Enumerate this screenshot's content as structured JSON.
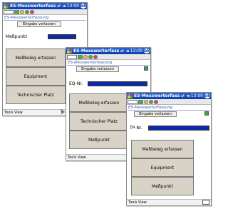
{
  "windows": [
    {
      "title": "ES-Messwerterfass",
      "time": "13:00",
      "subtitle": "ES-Messwerterfassung",
      "exit_button": "Eingabe verlassen",
      "field_label": "Meßpunkt",
      "buttons": [
        "Meßbeleg erfassen",
        "Equipment",
        "Technischer Platz"
      ],
      "menu": "Tools View"
    },
    {
      "title": "ES-Messwerterfass",
      "time": "13:00",
      "subtitle": "ES-Messwerterfassung",
      "exit_button": "Eingabe verlassen",
      "field_label": "EQ-Nr.",
      "buttons": [
        "Meßbeleg erfassen",
        "Technischer Platz",
        "Meßpunkt"
      ],
      "menu": "Tools View"
    },
    {
      "title": "ES-Messwerterfass",
      "time": "13:00",
      "subtitle": "ES-Messwerterfassung",
      "exit_button": "Eingabe verlassen",
      "field_label": "TP-Nr.",
      "buttons": [
        "Meßbeleg erfassen",
        "Equipment",
        "Meßpunkt"
      ],
      "menu": "Tools View"
    }
  ],
  "icons": {
    "connectivity": "sync-arrows-icon",
    "volume": "speaker-icon",
    "ok": "ok-button"
  },
  "colors": {
    "titlebar": "#0a3ea8",
    "input_field": "#0d2ba8",
    "button_face": "#d9d3c7"
  }
}
